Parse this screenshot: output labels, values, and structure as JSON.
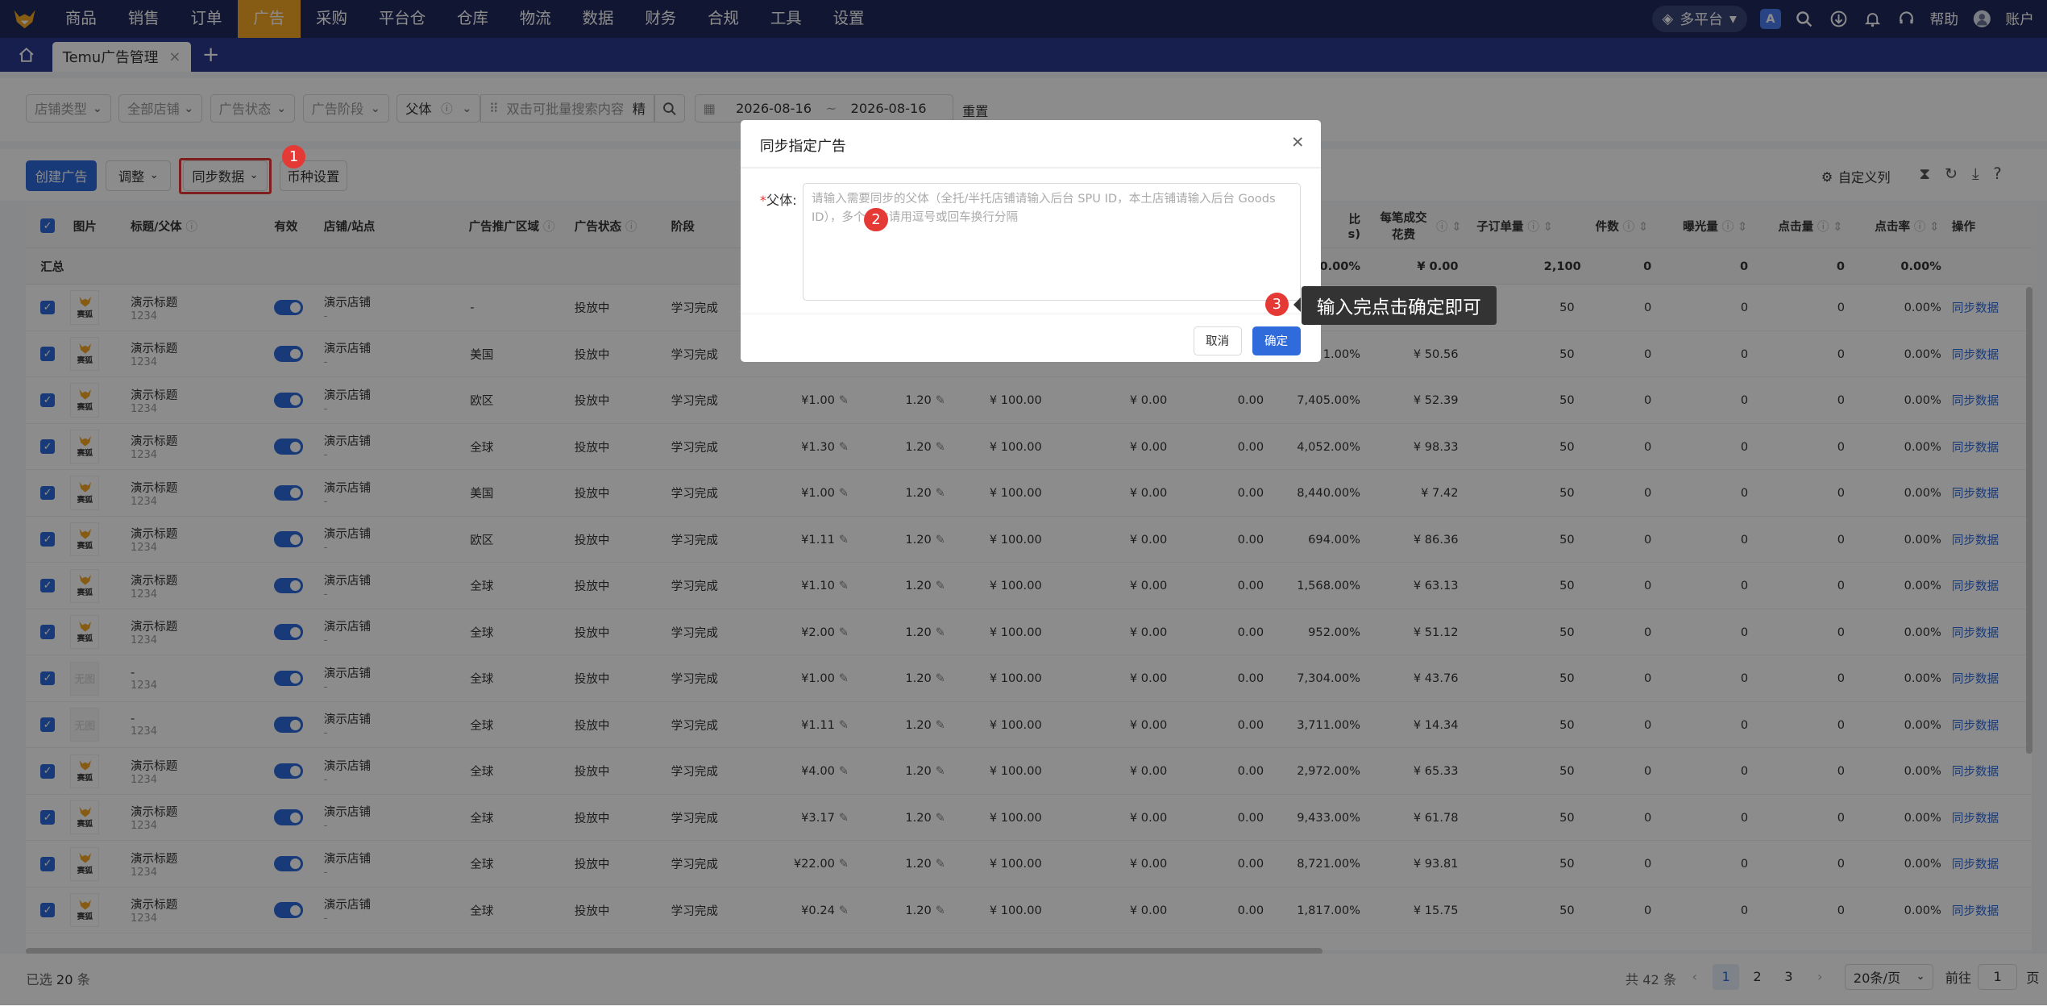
{
  "nav": {
    "items": [
      "商品",
      "销售",
      "订单",
      "广告",
      "采购",
      "平台仓",
      "仓库",
      "物流",
      "数据",
      "财务",
      "合规",
      "工具",
      "设置"
    ],
    "active_index": 3,
    "platform": "多平台",
    "help": "帮助",
    "account": "账户",
    "accent": "#f5a623"
  },
  "tabs": {
    "active": "Temu广告管理",
    "close": "×",
    "add": "+"
  },
  "filters": {
    "store_type": "店铺类型",
    "all_stores": "全部店铺",
    "ad_status": "广告状态",
    "ad_stage": "广告阶段",
    "parent": "父体",
    "search_placeholder": "双击可批量搜索内容",
    "precise": "精",
    "date_start": "2026-08-16",
    "date_sep": "~",
    "date_end": "2026-08-16",
    "reset": "重置"
  },
  "toolbar": {
    "create": "创建广告",
    "adjust": "调整",
    "sync": "同步数据",
    "currency": "币种设置",
    "custom_cols": "自定义列"
  },
  "table": {
    "headers": {
      "image": "图片",
      "title": "标题/父体",
      "valid": "有效",
      "store": "店铺/站点",
      "region": "广告推广区域",
      "status": "广告状态",
      "stage": "阶段",
      "ratio_a": "比",
      "ratio_b": "s)",
      "per_order_a": "每笔成交",
      "per_order_b": "花费",
      "sub_orders": "子订单量",
      "pieces": "件数",
      "impressions": "曝光量",
      "clicks": "点击量",
      "ctr": "点击率",
      "ops": "操作"
    },
    "summary": {
      "label": "汇总",
      "ratio": "0.00%",
      "per_order": "¥ 0.00",
      "sub_orders": "2,100",
      "pieces": "0",
      "impressions": "0",
      "clicks": "0",
      "ctr": "0.00%"
    },
    "rows": [
      {
        "img": "logo",
        "title": "演示标题",
        "id": "1234",
        "store": "演示店铺",
        "dash": "-",
        "region": "-",
        "status": "投放中",
        "stage": "学习完成",
        "bid": "",
        "roas": "",
        "budget": "",
        "spend": "",
        "ordv": "",
        "ratio": "",
        "per": "",
        "sub": "50",
        "pcs": "0",
        "imp": "0",
        "clk": "0",
        "ctr": "0.00%",
        "op": "同步数据"
      },
      {
        "img": "logo",
        "title": "演示标题",
        "id": "1234",
        "store": "演示店铺",
        "dash": "-",
        "region": "美国",
        "status": "投放中",
        "stage": "学习完成",
        "bid": "",
        "roas": "",
        "budget": "",
        "spend": "",
        "ordv": "",
        "ratio": "1.00%",
        "per": "¥ 50.56",
        "sub": "50",
        "pcs": "0",
        "imp": "0",
        "clk": "0",
        "ctr": "0.00%",
        "op": "同步数据"
      },
      {
        "img": "logo",
        "title": "演示标题",
        "id": "1234",
        "store": "演示店铺",
        "dash": "-",
        "region": "欧区",
        "status": "投放中",
        "stage": "学习完成",
        "bid": "¥1.00",
        "roas": "1.20",
        "budget": "¥ 100.00",
        "spend": "¥ 0.00",
        "ordv": "0.00",
        "ratio": "7,405.00%",
        "per": "¥ 52.39",
        "sub": "50",
        "pcs": "0",
        "imp": "0",
        "clk": "0",
        "ctr": "0.00%",
        "op": "同步数据"
      },
      {
        "img": "logo",
        "title": "演示标题",
        "id": "1234",
        "store": "演示店铺",
        "dash": "-",
        "region": "全球",
        "status": "投放中",
        "stage": "学习完成",
        "bid": "¥1.30",
        "roas": "1.20",
        "budget": "¥ 100.00",
        "spend": "¥ 0.00",
        "ordv": "0.00",
        "ratio": "4,052.00%",
        "per": "¥ 98.33",
        "sub": "50",
        "pcs": "0",
        "imp": "0",
        "clk": "0",
        "ctr": "0.00%",
        "op": "同步数据"
      },
      {
        "img": "logo",
        "title": "演示标题",
        "id": "1234",
        "store": "演示店铺",
        "dash": "-",
        "region": "美国",
        "status": "投放中",
        "stage": "学习完成",
        "bid": "¥1.00",
        "roas": "1.20",
        "budget": "¥ 100.00",
        "spend": "¥ 0.00",
        "ordv": "0.00",
        "ratio": "8,440.00%",
        "per": "¥ 7.42",
        "sub": "50",
        "pcs": "0",
        "imp": "0",
        "clk": "0",
        "ctr": "0.00%",
        "op": "同步数据"
      },
      {
        "img": "logo",
        "title": "演示标题",
        "id": "1234",
        "store": "演示店铺",
        "dash": "-",
        "region": "欧区",
        "status": "投放中",
        "stage": "学习完成",
        "bid": "¥1.11",
        "roas": "1.20",
        "budget": "¥ 100.00",
        "spend": "¥ 0.00",
        "ordv": "0.00",
        "ratio": "694.00%",
        "per": "¥ 86.36",
        "sub": "50",
        "pcs": "0",
        "imp": "0",
        "clk": "0",
        "ctr": "0.00%",
        "op": "同步数据"
      },
      {
        "img": "logo",
        "title": "演示标题",
        "id": "1234",
        "store": "演示店铺",
        "dash": "-",
        "region": "全球",
        "status": "投放中",
        "stage": "学习完成",
        "bid": "¥1.10",
        "roas": "1.20",
        "budget": "¥ 100.00",
        "spend": "¥ 0.00",
        "ordv": "0.00",
        "ratio": "1,568.00%",
        "per": "¥ 63.13",
        "sub": "50",
        "pcs": "0",
        "imp": "0",
        "clk": "0",
        "ctr": "0.00%",
        "op": "同步数据"
      },
      {
        "img": "logo",
        "title": "演示标题",
        "id": "1234",
        "store": "演示店铺",
        "dash": "-",
        "region": "全球",
        "status": "投放中",
        "stage": "学习完成",
        "bid": "¥2.00",
        "roas": "1.20",
        "budget": "¥ 100.00",
        "spend": "¥ 0.00",
        "ordv": "0.00",
        "ratio": "952.00%",
        "per": "¥ 51.12",
        "sub": "50",
        "pcs": "0",
        "imp": "0",
        "clk": "0",
        "ctr": "0.00%",
        "op": "同步数据"
      },
      {
        "img": "empty",
        "title": "-",
        "id": "1234",
        "store": "演示店铺",
        "dash": "-",
        "region": "全球",
        "status": "投放中",
        "stage": "学习完成",
        "bid": "¥1.00",
        "roas": "1.20",
        "budget": "¥ 100.00",
        "spend": "¥ 0.00",
        "ordv": "0.00",
        "ratio": "7,304.00%",
        "per": "¥ 43.76",
        "sub": "50",
        "pcs": "0",
        "imp": "0",
        "clk": "0",
        "ctr": "0.00%",
        "op": "同步数据"
      },
      {
        "img": "empty",
        "title": "-",
        "id": "1234",
        "store": "演示店铺",
        "dash": "-",
        "region": "全球",
        "status": "投放中",
        "stage": "学习完成",
        "bid": "¥1.11",
        "roas": "1.20",
        "budget": "¥ 100.00",
        "spend": "¥ 0.00",
        "ordv": "0.00",
        "ratio": "3,711.00%",
        "per": "¥ 14.34",
        "sub": "50",
        "pcs": "0",
        "imp": "0",
        "clk": "0",
        "ctr": "0.00%",
        "op": "同步数据"
      },
      {
        "img": "logo",
        "title": "演示标题",
        "id": "1234",
        "store": "演示店铺",
        "dash": "-",
        "region": "全球",
        "status": "投放中",
        "stage": "学习完成",
        "bid": "¥4.00",
        "roas": "1.20",
        "budget": "¥ 100.00",
        "spend": "¥ 0.00",
        "ordv": "0.00",
        "ratio": "2,972.00%",
        "per": "¥ 65.33",
        "sub": "50",
        "pcs": "0",
        "imp": "0",
        "clk": "0",
        "ctr": "0.00%",
        "op": "同步数据"
      },
      {
        "img": "logo",
        "title": "演示标题",
        "id": "1234",
        "store": "演示店铺",
        "dash": "-",
        "region": "全球",
        "status": "投放中",
        "stage": "学习完成",
        "bid": "¥3.17",
        "roas": "1.20",
        "budget": "¥ 100.00",
        "spend": "¥ 0.00",
        "ordv": "0.00",
        "ratio": "9,433.00%",
        "per": "¥ 61.78",
        "sub": "50",
        "pcs": "0",
        "imp": "0",
        "clk": "0",
        "ctr": "0.00%",
        "op": "同步数据"
      },
      {
        "img": "logo",
        "title": "演示标题",
        "id": "1234",
        "store": "演示店铺",
        "dash": "-",
        "region": "全球",
        "status": "投放中",
        "stage": "学习完成",
        "bid": "¥22.00",
        "roas": "1.20",
        "budget": "¥ 100.00",
        "spend": "¥ 0.00",
        "ordv": "0.00",
        "ratio": "8,721.00%",
        "per": "¥ 93.81",
        "sub": "50",
        "pcs": "0",
        "imp": "0",
        "clk": "0",
        "ctr": "0.00%",
        "op": "同步数据"
      },
      {
        "img": "logo",
        "title": "演示标题",
        "id": "1234",
        "store": "演示店铺",
        "dash": "-",
        "region": "全球",
        "status": "投放中",
        "stage": "学习完成",
        "bid": "¥0.24",
        "roas": "1.20",
        "budget": "¥ 100.00",
        "spend": "¥ 0.00",
        "ordv": "0.00",
        "ratio": "1,817.00%",
        "per": "¥ 15.75",
        "sub": "50",
        "pcs": "0",
        "imp": "0",
        "clk": "0",
        "ctr": "0.00%",
        "op": "同步数据"
      }
    ],
    "thumb_text": "赛狐",
    "thumb_empty": "无图"
  },
  "footer": {
    "selected_label": "已选",
    "selected_count": "20",
    "selected_unit": "条",
    "total": "共 42 条",
    "pages": [
      "1",
      "2",
      "3"
    ],
    "page_size": "20条/页",
    "goto_label": "前往",
    "goto_value": "1",
    "goto_unit": "页"
  },
  "modal": {
    "title": "同步指定广告",
    "label": "父体:",
    "required": "*",
    "placeholder": "请输入需要同步的父体（全托/半托店铺请输入后台 SPU ID，本土店铺请输入后台 Goods ID），多个父体请用逗号或回车换行分隔",
    "cancel": "取消",
    "ok": "确定"
  },
  "annotations": {
    "badge1": "1",
    "badge2": "2",
    "badge3": "3",
    "tooltip": "输入完点击确定即可",
    "badge_color": "#e53935"
  }
}
